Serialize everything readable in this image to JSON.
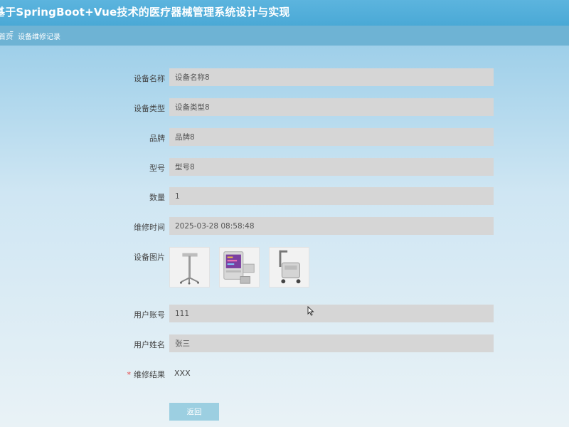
{
  "header": {
    "title": "基于SpringBoot+Vue技术的医疗器械管理系统设计与实现"
  },
  "breadcrumb": {
    "home": "首页",
    "separator": "Ξ",
    "current": "设备维修记录"
  },
  "form": {
    "device_name": {
      "label": "设备名称",
      "value": "设备名称8"
    },
    "device_type": {
      "label": "设备类型",
      "value": "设备类型8"
    },
    "brand": {
      "label": "品牌",
      "value": "品牌8"
    },
    "model": {
      "label": "型号",
      "value": "型号8"
    },
    "quantity": {
      "label": "数量",
      "value": "1"
    },
    "repair_time": {
      "label": "维修时间",
      "value": "2025-03-28 08:58:48"
    },
    "device_images": {
      "label": "设备图片",
      "images": [
        "iv-stand-image",
        "patient-monitor-image",
        "suction-cart-image"
      ]
    },
    "user_account": {
      "label": "用户账号",
      "value": "111"
    },
    "user_name": {
      "label": "用户姓名",
      "value": "张三"
    },
    "repair_result": {
      "label": "维修结果",
      "required_mark": "*",
      "value": "XXX"
    }
  },
  "actions": {
    "back_label": "返回"
  },
  "colors": {
    "topbar": "#4aa9d6",
    "crumbbar": "#6eb3d4",
    "field_bg": "#d6d6d6",
    "button": "#9ccfe1",
    "required": "#e64242"
  }
}
